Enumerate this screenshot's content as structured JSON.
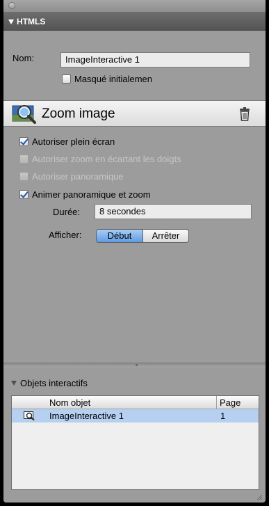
{
  "section": {
    "title": "HTMLS"
  },
  "form": {
    "name_label": "Nom:",
    "name_value": "ImageInteractive 1",
    "hidden_label": "Masqué initialemen"
  },
  "widget": {
    "title": "Zoom image"
  },
  "options": [
    {
      "label": "Autoriser plein écran",
      "checked": true,
      "enabled": true
    },
    {
      "label": "Autoriser zoom en écartant les doigts",
      "checked": false,
      "enabled": false
    },
    {
      "label": "Autoriser panoramique",
      "checked": false,
      "enabled": false
    },
    {
      "label": "Animer panoramique et zoom",
      "checked": true,
      "enabled": true
    }
  ],
  "duration": {
    "label": "Durée:",
    "value": "8 secondes"
  },
  "display": {
    "label": "Afficher:",
    "options": [
      "Début",
      "Arrêter"
    ],
    "selected": "Début"
  },
  "objects": {
    "title": "Objets interactifs",
    "columns": [
      "Nom objet",
      "Page"
    ],
    "rows": [
      {
        "name": "ImageInteractive 1",
        "page": "1",
        "icon": "zoom-image-icon",
        "selected": true
      }
    ]
  },
  "colors": {
    "panel_bg": "#9c9c9c",
    "header_bg": "#5e5e5e",
    "selection": "#b5d0f0",
    "accent": "#5e9be4"
  }
}
